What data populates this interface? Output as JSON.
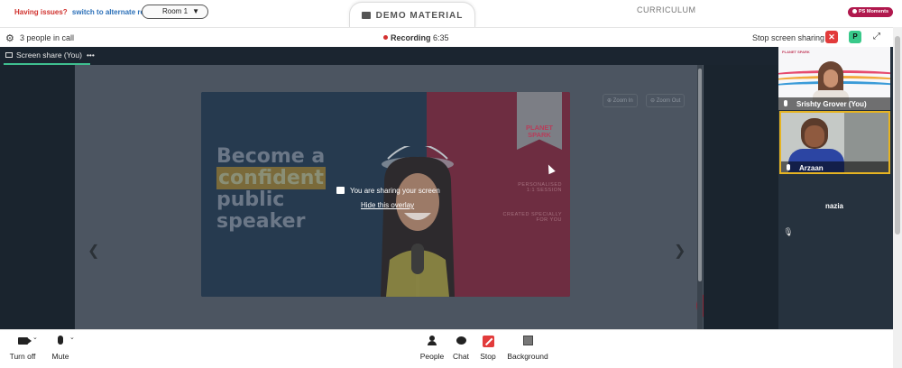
{
  "topbar": {
    "issues_text": "Having issues?",
    "alternate_link": "switch to alternate room",
    "room_select_value": "Room 1",
    "demo_tab_label": "DEMO MATERIAL",
    "curriculum_label": "CURRICULUM",
    "ps_moments_label": "PS Moments"
  },
  "callbar": {
    "people_in_call": "3 people in call",
    "recording_label": "Recording",
    "recording_time": "6:35",
    "stop_screen_sharing": "Stop screen sharing",
    "close_label": "✕",
    "p_label": "P"
  },
  "share": {
    "tab_label": "Screen share (You)",
    "tab_menu": "•••",
    "zoom_in": "Zoom In",
    "zoom_out": "Zoom Out",
    "overlay_message": "You are sharing your screen",
    "hide_overlay": "Hide this overlay"
  },
  "slide": {
    "line1": "Become a",
    "line2": "confident",
    "line3": "public",
    "line4": "speaker",
    "brand_line1": "PLANET",
    "brand_line2": "SPARK",
    "sub1a": "PERSONALISED",
    "sub1b": "1:1 SESSION",
    "sub2a": "CREATED SPECIALLY",
    "sub2b": "FOR YOU"
  },
  "participants": [
    {
      "name": "Srishty Grover (You)"
    },
    {
      "name": "Arzaan"
    },
    {
      "name": "nazia"
    }
  ],
  "tile_logo": "PLANET SPARK",
  "controls": {
    "turn_off": "Turn off",
    "mute": "Mute",
    "people": "People",
    "chat": "Chat",
    "stop": "Stop",
    "background": "Background"
  },
  "colors": {
    "accent_green": "#3fbf8f",
    "recording_red": "#d3302f",
    "stop_red": "#e23b3b",
    "active_tile_border": "#e6b422"
  },
  "icons": [
    "gear-icon",
    "folder-icon",
    "screen-share-icon",
    "search-zoom-icon",
    "share-icon",
    "mic-icon",
    "camera-icon",
    "person-icon",
    "chat-bubble-icon",
    "stop-share-icon",
    "background-icon",
    "expand-icon",
    "mic-muted-icon"
  ]
}
